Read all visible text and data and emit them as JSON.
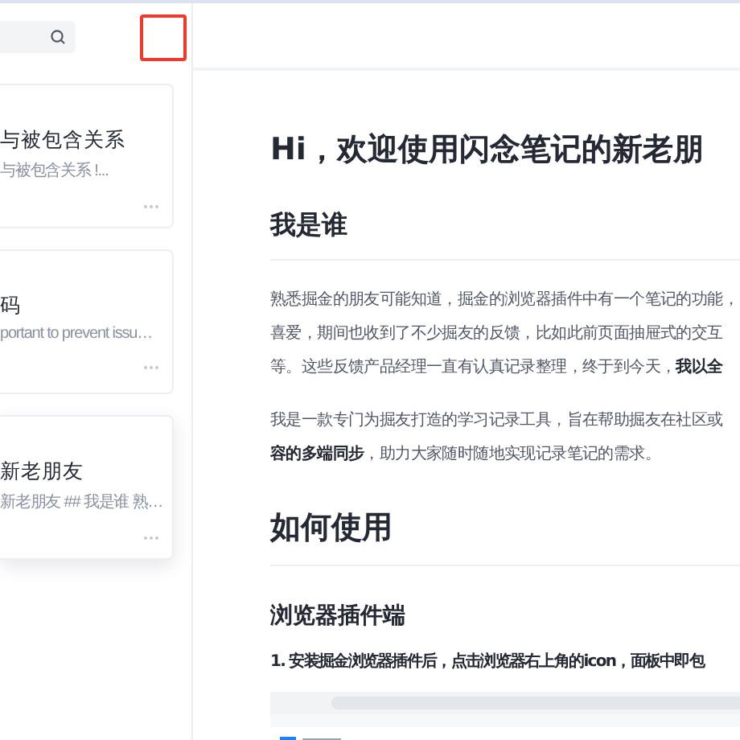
{
  "sidebar": {
    "notes": [
      {
        "title": "与被包含关系",
        "snippet": "与被包含关系 !...",
        "selected": false
      },
      {
        "title": "码",
        "snippet": "portant to prevent issu…",
        "selected": false
      },
      {
        "title": "新老朋友",
        "snippet": "新老朋友 ## 我是谁 熟…",
        "selected": true
      }
    ]
  },
  "article": {
    "title": "Hi，欢迎使用闪念笔记的新老朋",
    "blocks": [
      {
        "kind": "h2",
        "text": "我是谁"
      },
      {
        "kind": "lines",
        "lines": [
          "熟悉掘金的朋友可能知道，掘金的浏览器插件中有一个笔记的功能，",
          "喜爱，期间也收到了不少掘友的反馈，比如此前页面抽屉式的交互",
          "等。这些反馈产品经理一直有认真记录整理，终于到今天，**我以全**"
        ]
      },
      {
        "kind": "lines",
        "lines": [
          "我是一款专门为掘友打造的学习记录工具，旨在帮助掘友在社区或",
          "**容的多端同步**，助力大家随时随地实现记录笔记的需求。"
        ]
      },
      {
        "kind": "h2",
        "text": "如何使用"
      },
      {
        "kind": "h3",
        "text": "浏览器插件端"
      },
      {
        "kind": "strong",
        "text": "1. 安装掘金浏览器插件后，点击浏览器右上角的icon，面板中即包"
      },
      {
        "kind": "picture"
      }
    ]
  }
}
